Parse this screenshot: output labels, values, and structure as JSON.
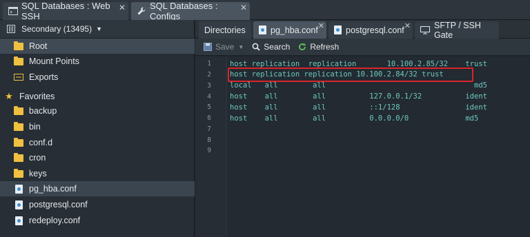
{
  "top_tabs": [
    {
      "label": "SQL Databases : Web SSH",
      "icon": "terminal-icon",
      "close": "✕"
    },
    {
      "label": "SQL Databases : Configs",
      "icon": "wrench-icon",
      "close": "✕"
    }
  ],
  "sidebar": {
    "node_label": "Secondary (13495)",
    "items": [
      {
        "label": "Root",
        "icon": "folder-icon"
      },
      {
        "label": "Mount Points",
        "icon": "folder-icon"
      },
      {
        "label": "Exports",
        "icon": "exports-icon"
      },
      {
        "label": "Favorites",
        "icon": "star-icon"
      },
      {
        "label": "backup",
        "icon": "folder-icon"
      },
      {
        "label": "bin",
        "icon": "folder-icon"
      },
      {
        "label": "conf.d",
        "icon": "folder-icon"
      },
      {
        "label": "cron",
        "icon": "folder-icon"
      },
      {
        "label": "keys",
        "icon": "folder-icon"
      },
      {
        "label": "pg_hba.conf",
        "icon": "config-file-icon"
      },
      {
        "label": "postgresql.conf",
        "icon": "config-file-icon"
      },
      {
        "label": "redeploy.conf",
        "icon": "config-file-icon"
      }
    ]
  },
  "panel_tabs": [
    {
      "label": "Directories"
    },
    {
      "label": "pg_hba.conf",
      "close": "✕"
    },
    {
      "label": "postgresql.conf",
      "close": "✕"
    },
    {
      "label": "SFTP / SSH Gate"
    }
  ],
  "toolbar": {
    "save": "Save",
    "search": "Search",
    "refresh": "Refresh"
  },
  "editor": {
    "line_numbers": [
      "1",
      "2",
      "3",
      "4",
      "5",
      "6",
      "7",
      "8",
      "9"
    ],
    "lines": [
      "host replication  replication       10.100.2.85/32    trust",
      "host replication replication 10.100.2.84/32 trust",
      "local   all        all                                  md5",
      "host    all        all          127.0.0.1/32          ident",
      "host    all        all          ::1/128               ident",
      "host    all        all          0.0.0.0/0             md5",
      "",
      "",
      ""
    ],
    "highlighted_line": 2
  },
  "colors": {
    "accent_highlight": "#d8262b",
    "code_text": "#6ec8c0",
    "folder": "#f0c040"
  }
}
